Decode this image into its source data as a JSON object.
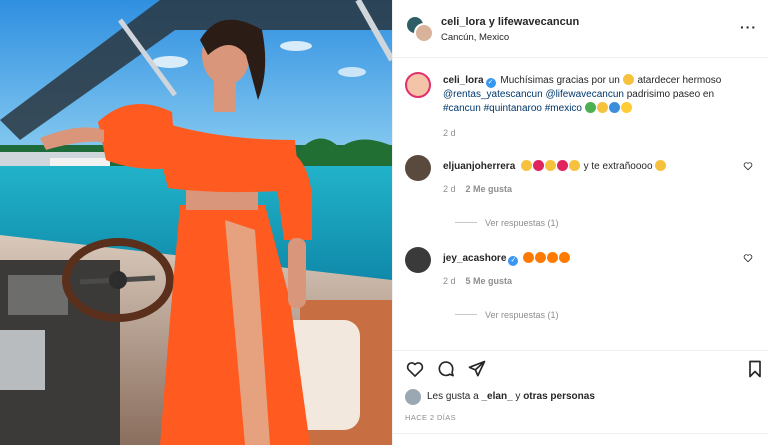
{
  "header": {
    "title": "celi_lora y lifewavecancun",
    "location": "Cancún, Mexico",
    "more": "···"
  },
  "caption": {
    "username": "celi_lora",
    "text_1": "Muchísimas gracias por un",
    "text_2": "atardecer hermoso",
    "mention_1": "@rentas_yatescancun",
    "mention_2": "@lifewavecancun",
    "text_3": "padrisimo paseo en",
    "hashtags": "#cancun #quintanaroo #mexico",
    "time": "2 d"
  },
  "comments": [
    {
      "username": "eljuanjoherrera",
      "text": "y te extrañoooo",
      "time": "2 d",
      "likes": "2 Me gusta",
      "replies": "Ver respuestas (1)"
    },
    {
      "username": "jey_acashore",
      "text": "",
      "time": "2 d",
      "likes": "5 Me gusta",
      "replies": "Ver respuestas (1)"
    }
  ],
  "likes": {
    "prefix": "Les gusta a",
    "user": "_elan_",
    "conj": "y",
    "others": "otras personas"
  },
  "posted_ago": "HACE 2 DÍAS",
  "icons": [
    "heart-icon",
    "comment-icon",
    "share-icon",
    "bookmark-icon",
    "more-icon",
    "verified-icon"
  ],
  "colors": {
    "accent": "#3897f0",
    "link": "#00376b",
    "muted": "#8e8e8e",
    "dress": "#ff5a1f"
  }
}
